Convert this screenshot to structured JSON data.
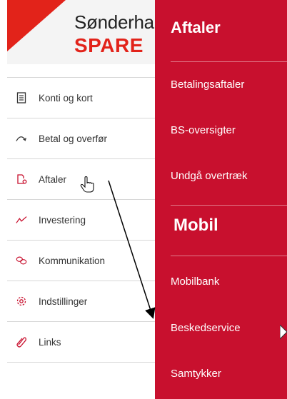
{
  "logo": {
    "line1": "Sønderha",
    "line2": "SPARE"
  },
  "colors": {
    "brand_red": "#e2231a",
    "dropdown_bg": "#c8102e"
  },
  "menu": {
    "items": [
      {
        "label": "Konti og kort",
        "icon": "account-card-icon"
      },
      {
        "label": "Betal og overfør",
        "icon": "transfer-arrow-icon"
      },
      {
        "label": "Aftaler",
        "icon": "agreement-document-icon"
      },
      {
        "label": "Investering",
        "icon": "investment-chart-icon"
      },
      {
        "label": "Kommunikation",
        "icon": "chat-bubbles-icon"
      },
      {
        "label": "Indstillinger",
        "icon": "gear-icon"
      },
      {
        "label": "Links",
        "icon": "paperclip-icon"
      }
    ]
  },
  "dropdown": {
    "header": "Aftaler",
    "links": [
      {
        "label": "Betalingsaftaler"
      },
      {
        "label": "BS-oversigter"
      },
      {
        "label": "Undgå overtræk"
      }
    ],
    "section_title": "Mobil",
    "section_links": [
      {
        "label": "Mobilbank"
      },
      {
        "label": "Beskedservice"
      },
      {
        "label": "Samtykker"
      }
    ]
  }
}
